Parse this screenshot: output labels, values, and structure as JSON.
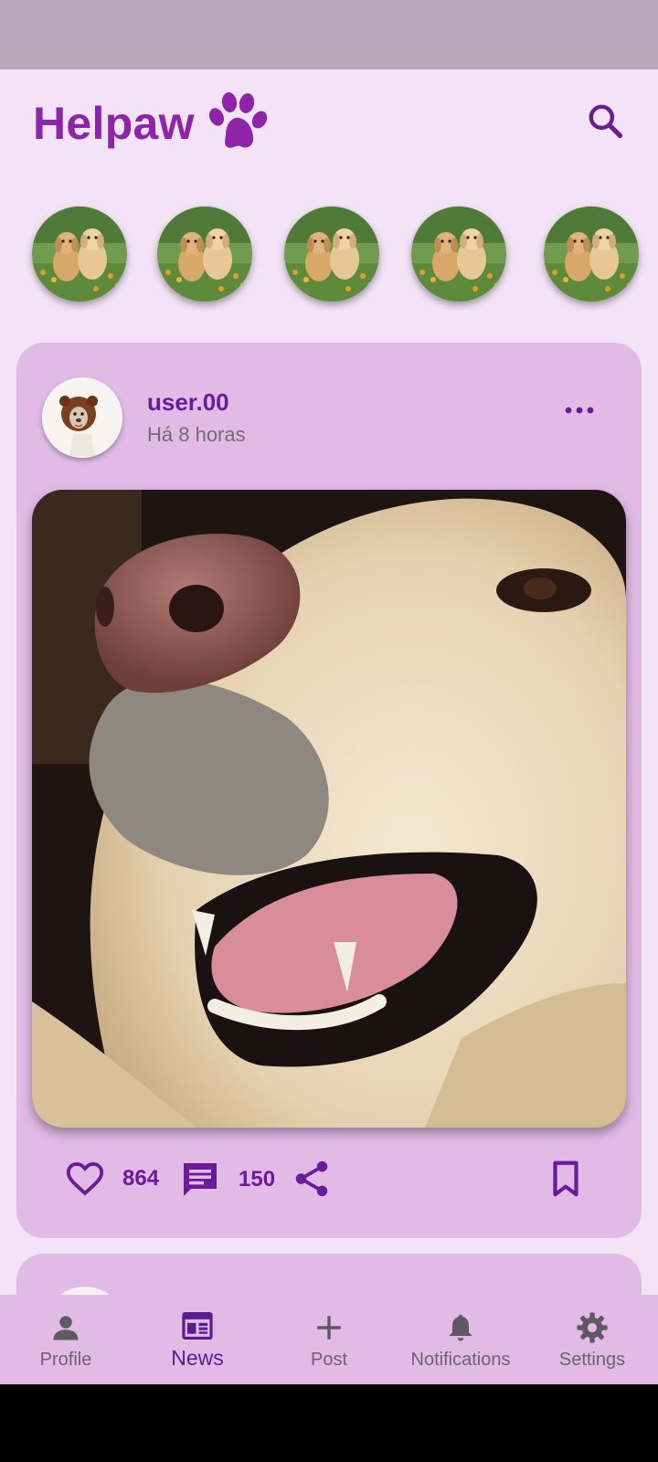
{
  "app": {
    "name": "Helpaw",
    "brand_color": "#8E24AA",
    "accent_color": "#6A1B9A",
    "logo_icon": "paw-icon",
    "search_icon": "search-icon"
  },
  "stories": [
    {
      "image": "two-golden-puppies-photo"
    },
    {
      "image": "two-golden-puppies-photo"
    },
    {
      "image": "two-golden-puppies-photo"
    },
    {
      "image": "two-golden-puppies-photo"
    },
    {
      "image": "two-golden-puppies-photo"
    }
  ],
  "post": {
    "username": "user.00",
    "time": "Há 8 horas",
    "avatar": "dog-in-lion-costume-photo",
    "image": "smiling-golden-dog-closeup-photo",
    "likes": "864",
    "comments": "150",
    "icons": [
      "heart-icon",
      "comment-icon",
      "share-icon",
      "bookmark-icon",
      "more-icon"
    ]
  },
  "nav": {
    "items": [
      {
        "label": "Profile",
        "icon": "person-icon",
        "active": false
      },
      {
        "label": "News",
        "icon": "newspaper-icon",
        "active": true
      },
      {
        "label": "Post",
        "icon": "plus-icon",
        "active": false
      },
      {
        "label": "Notifications",
        "icon": "bell-icon",
        "active": false
      },
      {
        "label": "Settings",
        "icon": "gear-icon",
        "active": false
      }
    ]
  }
}
